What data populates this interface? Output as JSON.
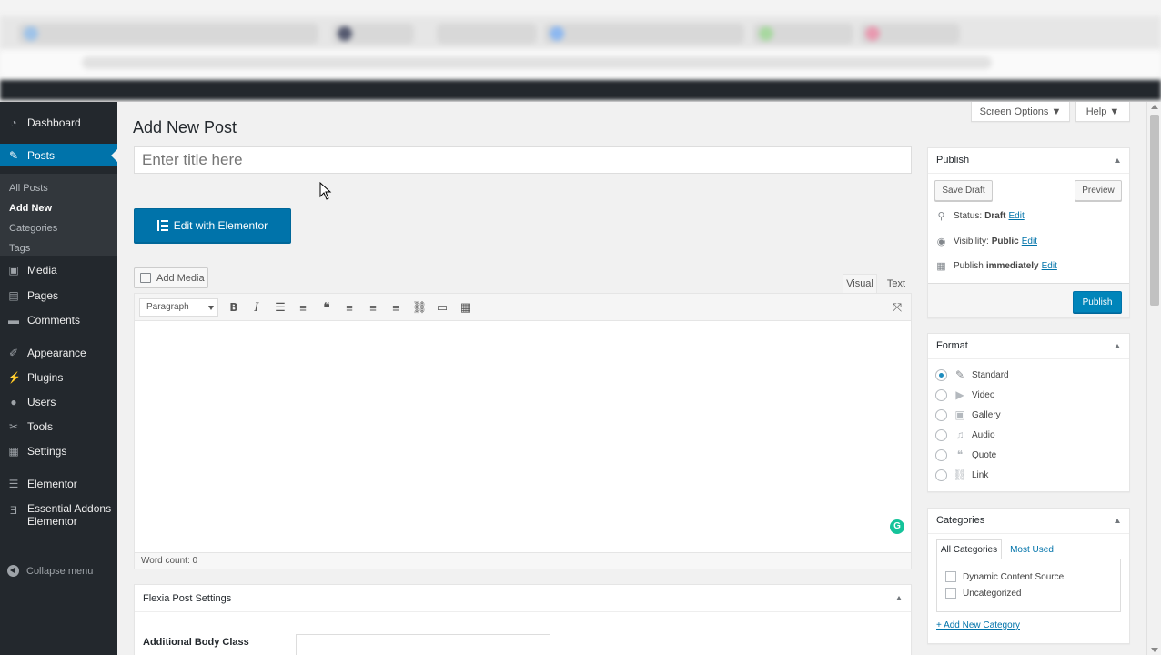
{
  "sidebar": {
    "items": [
      {
        "label": "Dashboard",
        "icon": "dashboard-icon"
      },
      {
        "label": "Posts",
        "icon": "pin-icon"
      },
      {
        "label": "Media",
        "icon": "media-icon"
      },
      {
        "label": "Pages",
        "icon": "pages-icon"
      },
      {
        "label": "Comments",
        "icon": "comments-icon"
      },
      {
        "label": "Appearance",
        "icon": "brush-icon"
      },
      {
        "label": "Plugins",
        "icon": "plugin-icon"
      },
      {
        "label": "Users",
        "icon": "users-icon"
      },
      {
        "label": "Tools",
        "icon": "wrench-icon"
      },
      {
        "label": "Settings",
        "icon": "settings-icon"
      },
      {
        "label": "Elementor",
        "icon": "elementor-icon"
      },
      {
        "label": "Essential Addons",
        "label2": "Elementor",
        "icon": "ea-icon"
      }
    ],
    "submenu": [
      "All Posts",
      "Add New",
      "Categories",
      "Tags"
    ],
    "collapse": "Collapse menu"
  },
  "header": {
    "screen_options": "Screen Options ▼",
    "help": "Help ▼",
    "page_title": "Add New Post"
  },
  "editor": {
    "title_placeholder": "Enter title here",
    "elementor_button": "Edit with Elementor",
    "add_media": "Add Media",
    "tab_visual": "Visual",
    "tab_text": "Text",
    "format_select": "Paragraph",
    "word_count": "Word count: 0"
  },
  "publish": {
    "title": "Publish",
    "save_draft": "Save Draft",
    "preview": "Preview",
    "status_label": "Status:",
    "status_value": "Draft",
    "visibility_label": "Visibility:",
    "visibility_value": "Public",
    "publish_label": "Publish",
    "publish_value": "immediately",
    "edit": "Edit",
    "publish_button": "Publish"
  },
  "format": {
    "title": "Format",
    "options": [
      "Standard",
      "Video",
      "Gallery",
      "Audio",
      "Quote",
      "Link"
    ],
    "selected": "Standard"
  },
  "categories": {
    "title": "Categories",
    "tab_all": "All Categories",
    "tab_most": "Most Used",
    "items": [
      "Dynamic Content Source",
      "Uncategorized"
    ],
    "add_new": "+ Add New Category"
  },
  "flexia": {
    "title": "Flexia Post Settings",
    "field_label": "Additional Body Class"
  },
  "colors": {
    "accent": "#0073aa",
    "sidebar_bg": "#23282d",
    "primary_button": "#0085ba"
  }
}
